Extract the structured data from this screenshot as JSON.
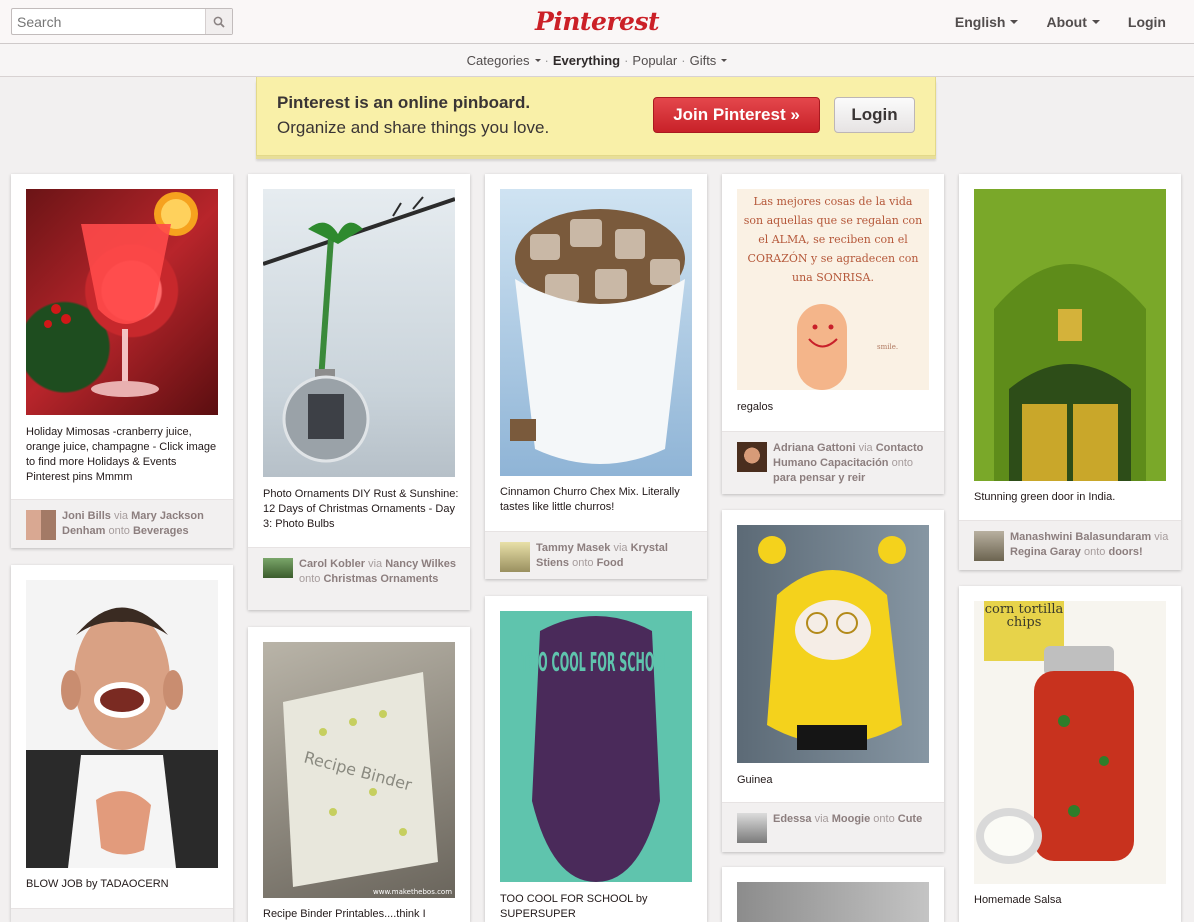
{
  "header": {
    "search_placeholder": "Search",
    "logo": "Pinterest",
    "nav": {
      "english": "English",
      "about": "About",
      "login": "Login"
    }
  },
  "subnav": {
    "categories": "Categories",
    "everything": "Everything",
    "popular": "Popular",
    "gifts": "Gifts"
  },
  "banner": {
    "title": "Pinterest is an online pinboard.",
    "subtitle": "Organize and share things you love.",
    "join": "Join Pinterest »",
    "login": "Login"
  },
  "pins": [
    {
      "desc": "Holiday Mimosas -cranberry juice, orange juice, champagne - Click image to find more Holidays & Events Pinterest pins Mmmm",
      "user": "Joni Bills",
      "via": "Mary Jackson Denham",
      "board": "Beverages"
    },
    {
      "desc": "Photo Ornaments DIY Rust & Sunshine: 12 Days of Christmas Ornaments - Day 3: Photo Bulbs",
      "user": "Carol Kobler",
      "via": "Nancy Wilkes",
      "board": "Christmas Ornaments"
    },
    {
      "desc": "Cinnamon Churro Chex Mix. Literally tastes like little churros!",
      "user": "Tammy Masek",
      "via": "Krystal Stiens",
      "board": "Food"
    },
    {
      "desc": "regalos",
      "user": "Adriana Gattoni",
      "via": "Contacto Humano Capacitación",
      "board": "para pensar y reir",
      "quote": "Las mejores cosas de la vida son aquellas que se regalan con el ALMA, se reciben con el CORAZÓN y se agradecen con una SONRISA.",
      "quote_sig": "smile."
    },
    {
      "desc": "Stunning green door in India.",
      "user": "Manashwini Balasundaram",
      "via": "Regina Garay",
      "board": "doors!"
    },
    {
      "desc": "BLOW JOB by TADAOCERN"
    },
    {
      "desc": "Recipe Binder Printables....think I",
      "img_text": "Recipe Binder",
      "img_credit": "www.makethebos.com"
    },
    {
      "desc": "TOO COOL FOR SCHOOL by SUPERSUPER",
      "poster_text": "TOO COOL FOR SCHOOL"
    },
    {
      "desc": "Guinea",
      "user": "Edessa",
      "via": "Moogie",
      "board": "Cute"
    },
    {
      "desc": "Homemade Salsa",
      "img_text": "corn tortilla chips"
    }
  ],
  "words": {
    "via": "via",
    "onto": "onto"
  },
  "colors": {
    "brand": "#cb2027",
    "background": "#f2f0f0",
    "banner": "#f9f0a8"
  }
}
